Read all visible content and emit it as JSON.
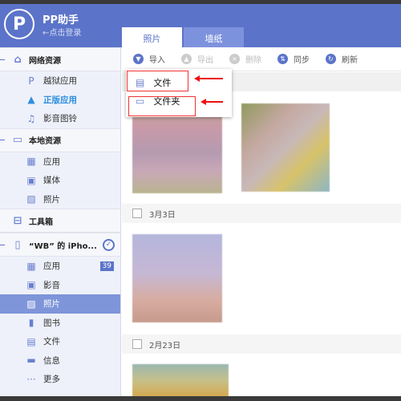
{
  "app": {
    "title": "PP助手",
    "login": "←点击登录",
    "logo": "P"
  },
  "tabs": [
    {
      "label": "照片"
    },
    {
      "label": "墙纸"
    }
  ],
  "sidebar": {
    "network": {
      "label": "网络资源",
      "items": [
        {
          "label": "越狱应用"
        },
        {
          "label": "正版应用"
        },
        {
          "label": "影音图铃"
        }
      ]
    },
    "local": {
      "label": "本地资源",
      "items": [
        {
          "label": "应用"
        },
        {
          "label": "媒体"
        },
        {
          "label": "照片"
        }
      ]
    },
    "toolbox": {
      "label": "工具箱"
    },
    "device": {
      "label": "“WB” 的 iPho...",
      "items": [
        {
          "label": "应用",
          "badge": "39"
        },
        {
          "label": "影音"
        },
        {
          "label": "照片"
        },
        {
          "label": "图书"
        },
        {
          "label": "文件"
        },
        {
          "label": "信息"
        },
        {
          "label": "更多"
        }
      ]
    }
  },
  "toolbar": {
    "import": "导入",
    "export": "导出",
    "delete": "删除",
    "sync": "同步",
    "refresh": "刷新"
  },
  "import_menu": {
    "items": [
      {
        "label": "文件"
      },
      {
        "label": "文件夹"
      }
    ]
  },
  "groups": [
    {
      "date": "3月3日"
    },
    {
      "date": "2月23日"
    }
  ],
  "colors": {
    "accent": "#5b74c9",
    "active_item": "#7f95d9",
    "annotation": "#e11111"
  }
}
